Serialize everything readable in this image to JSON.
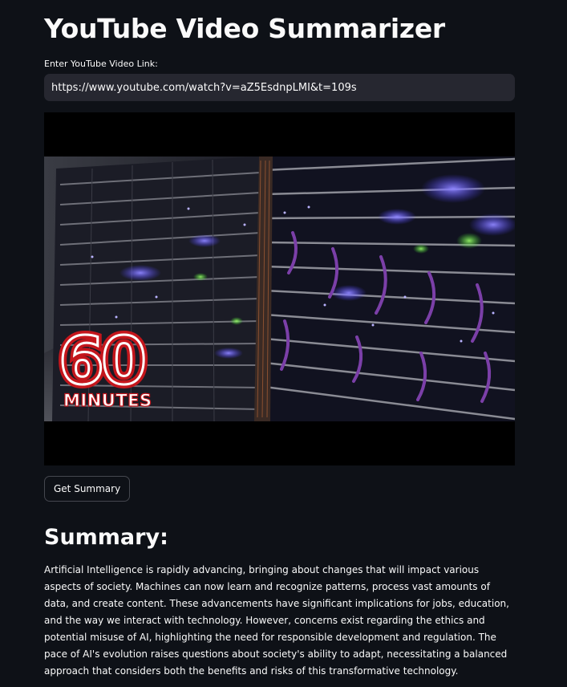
{
  "page": {
    "title": "YouTube Video Summarizer"
  },
  "input": {
    "label": "Enter YouTube Video Link:",
    "value": "https://www.youtube.com/watch?v=aZ5EsdnpLMI&t=109s"
  },
  "video": {
    "logo_number": "60",
    "logo_word": "MINUTES"
  },
  "actions": {
    "get_summary_label": "Get Summary"
  },
  "summary": {
    "heading": "Summary:",
    "text": "Artificial Intelligence is rapidly advancing, bringing about changes that will impact various aspects of society. Machines can now learn and recognize patterns, process vast amounts of data, and create content. These advancements have significant implications for jobs, education, and the way we interact with technology. However, concerns exist regarding the ethics and potential misuse of AI, highlighting the need for responsible development and regulation. The pace of AI's evolution raises questions about society's ability to adapt, necessitating a balanced approach that considers both the benefits and risks of this transformative technology."
  },
  "colors": {
    "background": "#0e1117",
    "input_background": "#262730",
    "button_border": "#45474f",
    "text": "#fafafa",
    "logo_red": "#c4161c"
  }
}
